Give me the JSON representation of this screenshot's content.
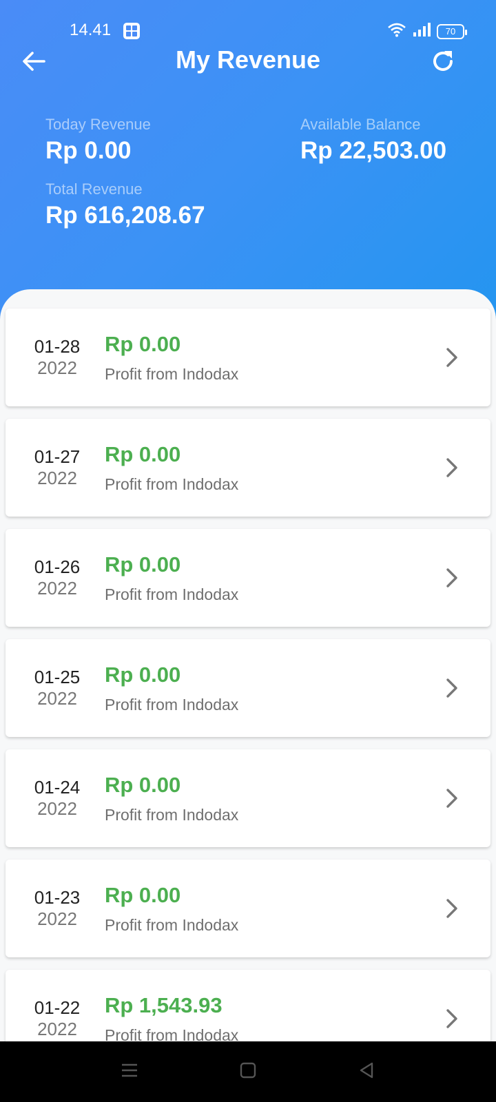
{
  "status_bar": {
    "time": "14.41",
    "battery": "70"
  },
  "header": {
    "title": "My Revenue"
  },
  "stats": {
    "today_label": "Today Revenue",
    "today_value": "Rp 0.00",
    "available_label": "Available Balance",
    "available_value": "Rp 22,503.00",
    "total_label": "Total Revenue",
    "total_value": "Rp 616,208.67"
  },
  "entries": [
    {
      "md": "01-28",
      "year": "2022",
      "amount": "Rp 0.00",
      "desc": "Profit from Indodax"
    },
    {
      "md": "01-27",
      "year": "2022",
      "amount": "Rp 0.00",
      "desc": "Profit from Indodax"
    },
    {
      "md": "01-26",
      "year": "2022",
      "amount": "Rp 0.00",
      "desc": "Profit from Indodax"
    },
    {
      "md": "01-25",
      "year": "2022",
      "amount": "Rp 0.00",
      "desc": "Profit from Indodax"
    },
    {
      "md": "01-24",
      "year": "2022",
      "amount": "Rp 0.00",
      "desc": "Profit from Indodax"
    },
    {
      "md": "01-23",
      "year": "2022",
      "amount": "Rp 0.00",
      "desc": "Profit from Indodax"
    },
    {
      "md": "01-22",
      "year": "2022",
      "amount": "Rp 1,543.93",
      "desc": "Profit from Indodax"
    }
  ],
  "colors": {
    "header_gradient_start": "#4a8cf7",
    "header_gradient_end": "#2495f0",
    "amount_green": "#4caf50"
  },
  "icons": [
    "back-arrow-icon",
    "refresh-icon",
    "chevron-right-icon",
    "wifi-icon",
    "signal-icon",
    "menu-icon",
    "home-icon",
    "back-triangle-icon"
  ]
}
